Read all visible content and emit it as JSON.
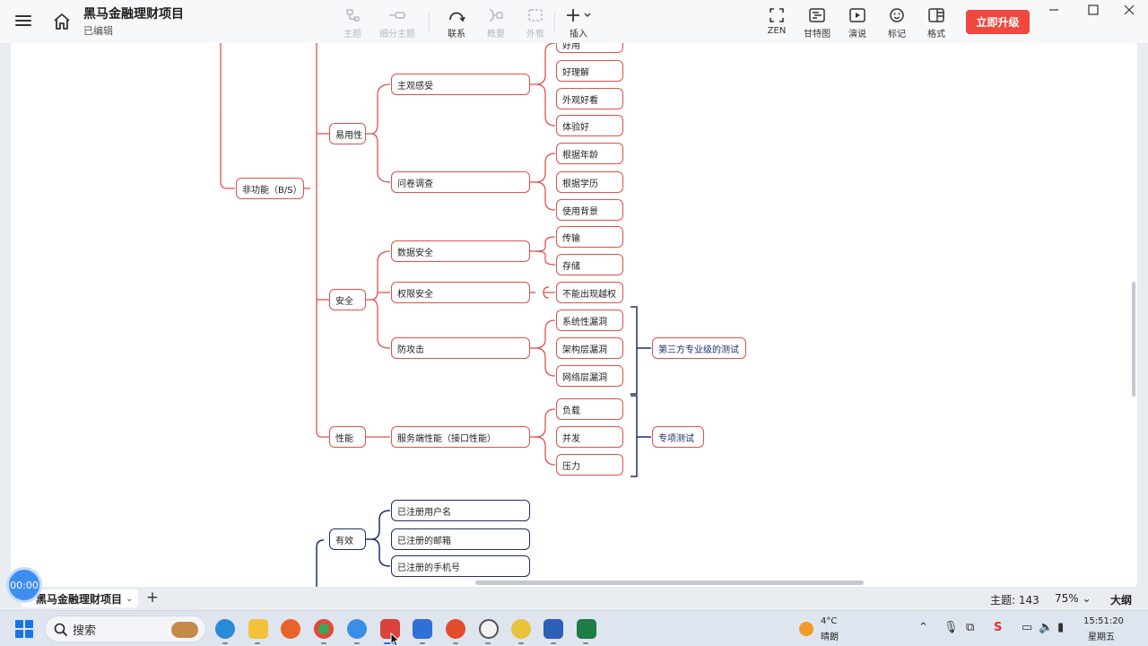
{
  "header": {
    "doc_title": "黑马金融理财项目",
    "doc_status": "已编辑",
    "tools": [
      {
        "id": "subtopic",
        "label": "主题",
        "icon": "subtopic-icon",
        "disabled": true
      },
      {
        "id": "split",
        "label": "细分主题",
        "icon": "split-topic-icon",
        "disabled": true
      },
      {
        "id": "relation",
        "label": "联系",
        "icon": "relation-icon",
        "disabled": false
      },
      {
        "id": "summary",
        "label": "概要",
        "icon": "summary-icon",
        "disabled": true
      },
      {
        "id": "boundary",
        "label": "外框",
        "icon": "boundary-icon",
        "disabled": true
      },
      {
        "id": "insert",
        "label": "插入",
        "icon": "plus-icon",
        "disabled": false
      },
      {
        "id": "zen",
        "label": "ZEN",
        "icon": "zen-icon",
        "disabled": false
      },
      {
        "id": "gantt",
        "label": "甘特图",
        "icon": "gantt-icon",
        "disabled": false
      },
      {
        "id": "present",
        "label": "演说",
        "icon": "play-icon",
        "disabled": false
      },
      {
        "id": "marker",
        "label": "标记",
        "icon": "smiley-icon",
        "disabled": false
      },
      {
        "id": "format",
        "label": "格式",
        "icon": "panel-icon",
        "disabled": false
      }
    ],
    "upgrade_label": "立即升级",
    "accent": "#f0483e"
  },
  "mindmap": {
    "root": "非功能（B/S）",
    "usability": {
      "label": "易用性",
      "subjective": {
        "label": "主观感受",
        "items": [
          "好用",
          "好理解",
          "外观好看",
          "体验好"
        ]
      },
      "survey": {
        "label": "问卷调查",
        "items": [
          "根据年龄",
          "根据学历",
          "使用背景"
        ]
      }
    },
    "security": {
      "label": "安全",
      "data": {
        "label": "数据安全",
        "items": [
          "传输",
          "存储"
        ]
      },
      "permission": {
        "label": "权限安全",
        "items": [
          "不能出现越权"
        ]
      },
      "attack": {
        "label": "防攻击",
        "items": [
          "系统性漏洞",
          "架构层漏洞",
          "网络层漏洞"
        ],
        "summary": "第三方专业级的测试"
      }
    },
    "performance": {
      "label": "性能",
      "server": {
        "label": "服务端性能（接口性能）",
        "items": [
          "负载",
          "并发",
          "压力"
        ],
        "summary": "专项测试"
      }
    },
    "valid": {
      "label": "有效",
      "items": [
        "已注册用户名",
        "已注册的邮箱",
        "已注册的手机号"
      ]
    },
    "node_color": "#e0504c",
    "line_color": "#e0504c",
    "alt_color": "#1f2f6b"
  },
  "timer": "00:00",
  "footer": {
    "sheet_name": "黑马金融理财项目",
    "add_sheet": "+",
    "topic_count": "主题: 143",
    "zoom": "75%",
    "outline": "大纲"
  },
  "taskbar": {
    "search_placeholder": "搜索",
    "weather_temp": "4°C",
    "weather_desc": "晴朗",
    "time": "15:51:20",
    "day": "星期五"
  }
}
